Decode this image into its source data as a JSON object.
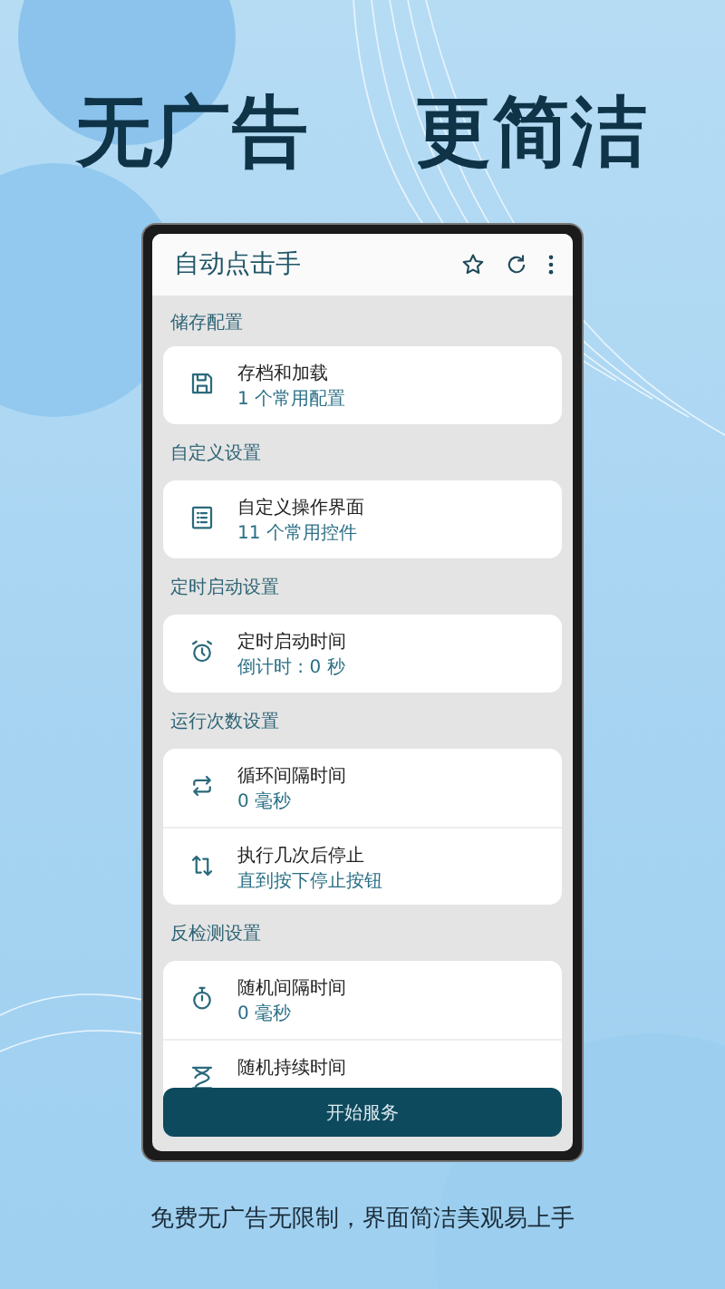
{
  "headline": [
    "无广告",
    "更简洁"
  ],
  "app": {
    "title": "自动点击手"
  },
  "sections": [
    {
      "title": "储存配置",
      "items": [
        {
          "kind": "save",
          "title": "存档和加载",
          "subtitle": "1 个常用配置"
        }
      ]
    },
    {
      "title": "自定义设置",
      "items": [
        {
          "kind": "list",
          "title": "自定义操作界面",
          "subtitle": "11 个常用控件"
        }
      ]
    },
    {
      "title": "定时启动设置",
      "items": [
        {
          "kind": "alarm",
          "title": "定时启动时间",
          "subtitle": "倒计时 : 0 秒"
        }
      ]
    },
    {
      "title": "运行次数设置",
      "items": [
        {
          "kind": "repeat",
          "title": "循环间隔时间",
          "subtitle": "0 毫秒"
        },
        {
          "kind": "loop",
          "title": "执行几次后停止",
          "subtitle": "直到按下停止按钮"
        }
      ]
    },
    {
      "title": "反检测设置",
      "items": [
        {
          "kind": "stopwatch",
          "title": "随机间隔时间",
          "subtitle": "0 毫秒"
        },
        {
          "kind": "hourglass",
          "title": "随机持续时间"
        }
      ]
    }
  ],
  "start_button": "开始服务",
  "caption": "免费无广告无限制，界面简洁美观易上手"
}
